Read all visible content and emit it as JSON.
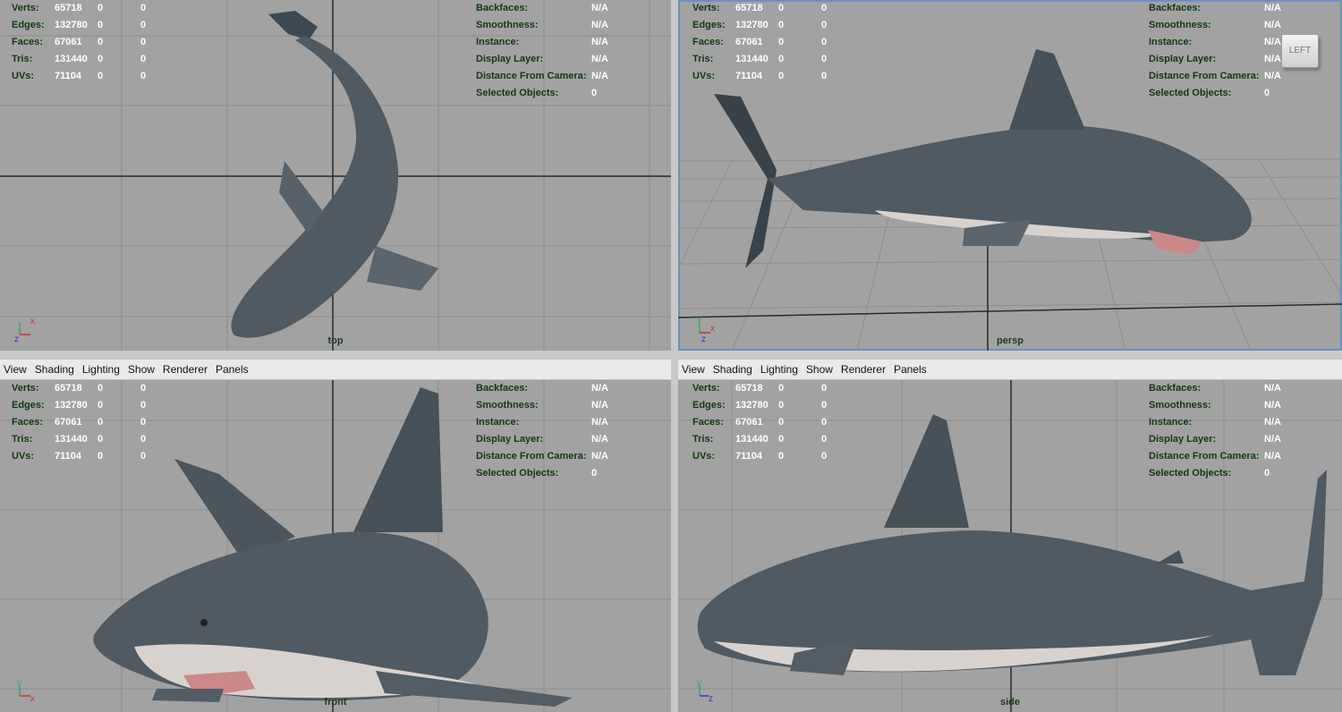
{
  "menu": [
    "View",
    "Shading",
    "Lighting",
    "Show",
    "Renderer",
    "Panels"
  ],
  "stats_left": [
    {
      "label": "Verts:",
      "v1": "65718",
      "v2": "0",
      "v3": "0"
    },
    {
      "label": "Edges:",
      "v1": "132780",
      "v2": "0",
      "v3": "0"
    },
    {
      "label": "Faces:",
      "v1": "67061",
      "v2": "0",
      "v3": "0"
    },
    {
      "label": "Tris:",
      "v1": "131440",
      "v2": "0",
      "v3": "0"
    },
    {
      "label": "UVs:",
      "v1": "71104",
      "v2": "0",
      "v3": "0"
    }
  ],
  "stats_right": [
    {
      "label": "Backfaces:",
      "value": "N/A"
    },
    {
      "label": "Smoothness:",
      "value": "N/A"
    },
    {
      "label": "Instance:",
      "value": "N/A"
    },
    {
      "label": "Display Layer:",
      "value": "N/A"
    },
    {
      "label": "Distance From Camera:",
      "value": "N/A"
    },
    {
      "label": "Selected Objects:",
      "value": "0"
    }
  ],
  "panels": {
    "top": {
      "camera": "top"
    },
    "persp": {
      "camera": "persp",
      "viewcube": "LEFT"
    },
    "front": {
      "camera": "front"
    },
    "side": {
      "camera": "side"
    }
  },
  "axis_labels": {
    "x": "x",
    "y": "y",
    "z": "z"
  },
  "colors": {
    "viewport_bg": "#a2a2a2",
    "shark_body": "#4f5a63",
    "shark_belly": "#d8d2cf",
    "hud_text": "#103a10",
    "active_border": "#6a8fc4"
  }
}
